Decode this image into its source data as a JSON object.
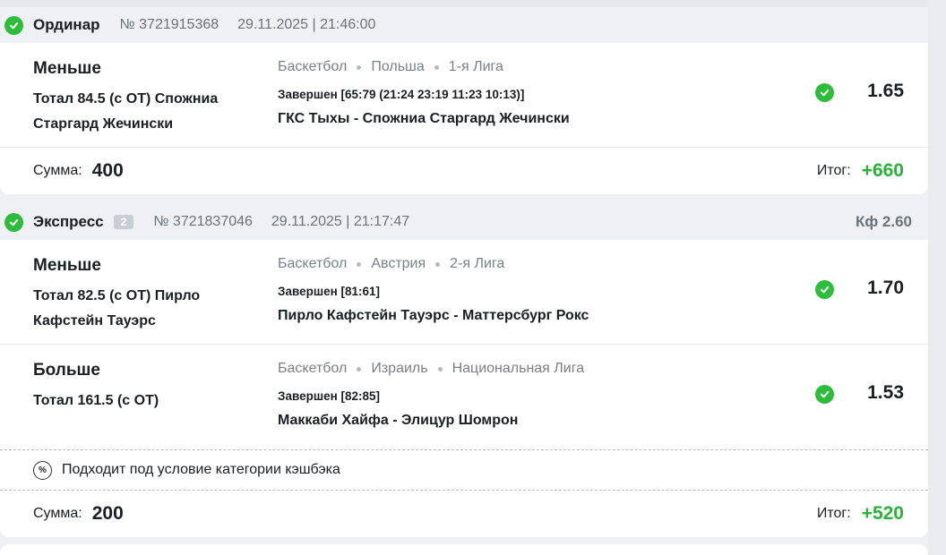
{
  "colors": {
    "success": "#2ebd3a",
    "win_text": "#27b338",
    "header_bg": "#eef0f3",
    "muted_text": "#6c727c"
  },
  "bets": [
    {
      "type": "Ординар",
      "number": "№ 3721915368",
      "date": "29.11.2025 | 21:46:00",
      "status_icon": "check-circle-icon",
      "events": [
        {
          "outcome": "Меньше",
          "market": "Тотал 84.5 (с ОТ) Спожниа Старгард Жечински",
          "sport": "Баскетбол",
          "country": "Польша",
          "league": "1-я Лига",
          "status": "Завершен [65:79 (21:24 23:19 11:23 10:13)]",
          "teams": "ГКС Тыхы - Спожниа Старгард Жечински",
          "odds": "1.65"
        }
      ],
      "footer": {
        "sum_label": "Сумма:",
        "sum": "400",
        "result_label": "Итог:",
        "result": "+660"
      }
    },
    {
      "type": "Экспресс",
      "count": "2",
      "number": "№ 3721837046",
      "date": "29.11.2025 | 21:17:47",
      "total_coef": "Кф 2.60",
      "status_icon": "check-circle-icon",
      "events": [
        {
          "outcome": "Меньше",
          "market": "Тотал 82.5 (с ОТ) Пирло Кафстейн Тауэрс",
          "sport": "Баскетбол",
          "country": "Австрия",
          "league": "2-я Лига",
          "status": "Завершен [81:61]",
          "teams": "Пирло Кафстейн Тауэрс - Маттерсбург Рокс",
          "odds": "1.70"
        },
        {
          "outcome": "Больше",
          "market": "Тотал 161.5 (с ОТ)",
          "sport": "Баскетбол",
          "country": "Израиль",
          "league": "Национальная Лига",
          "status": "Завершен [82:85]",
          "teams": "Маккаби Хайфа - Элицур Шомрон",
          "odds": "1.53"
        }
      ],
      "cashback": {
        "icon": "percent-icon",
        "text": "Подходит под условие категории кэшбэка"
      },
      "footer": {
        "sum_label": "Сумма:",
        "sum": "200",
        "result_label": "Итог:",
        "result": "+520"
      }
    }
  ]
}
